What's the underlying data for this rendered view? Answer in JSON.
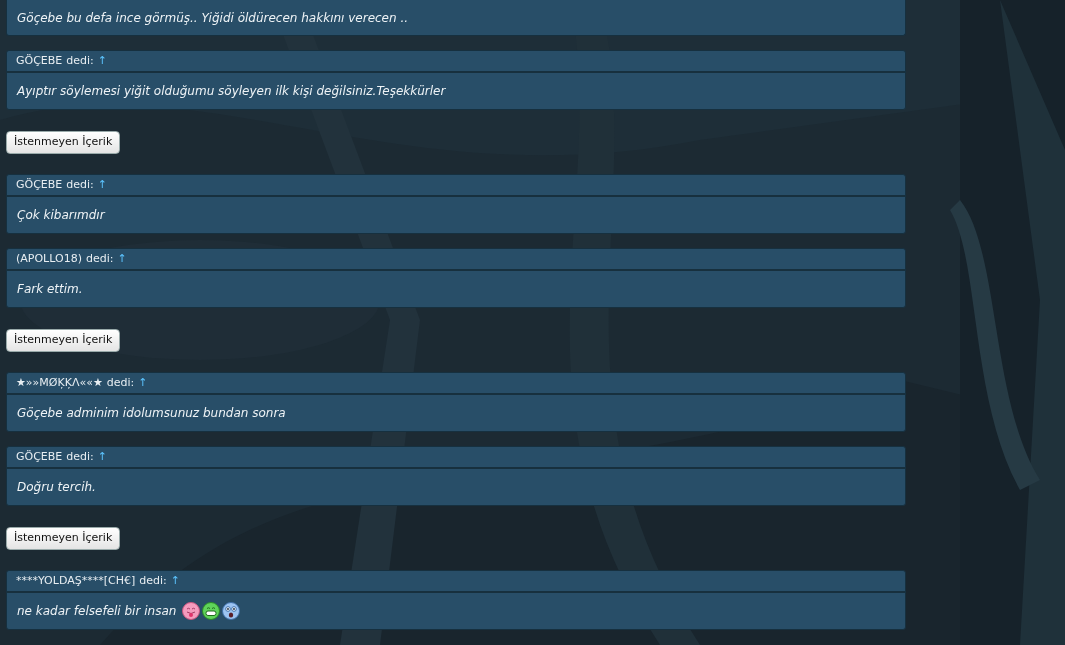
{
  "posts": [
    {
      "kind": "quote",
      "body": "Göçebe bu defa ince görmüş.. Yiğidi öldürecen hakkını verecen .."
    },
    {
      "kind": "quote",
      "author": "GÖÇEBE",
      "said": "dedi:",
      "arrow": "↑",
      "body": "Ayıptır söylemesi yiğit olduğumu söyleyen ilk kişi değilsiniz.Teşekkürler"
    },
    {
      "kind": "button",
      "label": "İstenmeyen İçerik"
    },
    {
      "kind": "quote",
      "author": "GÖÇEBE",
      "said": "dedi:",
      "arrow": "↑",
      "body": "Çok kibarımdır"
    },
    {
      "kind": "quote",
      "author": "(APOLLO18)",
      "said": "dedi:",
      "arrow": "↑",
      "body": "Fark ettim."
    },
    {
      "kind": "button",
      "label": "İstenmeyen İçerik"
    },
    {
      "kind": "quote",
      "author": "★»»MØĶĶΛ««★",
      "said": "dedi:",
      "arrow": "↑",
      "body": "Göçebe adminim idolumsunuz bundan sonra"
    },
    {
      "kind": "quote",
      "author": "GÖÇEBE",
      "said": "dedi:",
      "arrow": "↑",
      "body": "Doğru tercih."
    },
    {
      "kind": "button",
      "label": "İstenmeyen İçerik"
    },
    {
      "kind": "quote",
      "author": "****YOLDAŞ****[CH€]",
      "said": "dedi:",
      "arrow": "↑",
      "body": "ne kadar felsefeli bir insan",
      "emoticons": [
        {
          "kind": "tongue"
        },
        {
          "kind": "grin"
        },
        {
          "kind": "scared"
        }
      ]
    }
  ]
}
